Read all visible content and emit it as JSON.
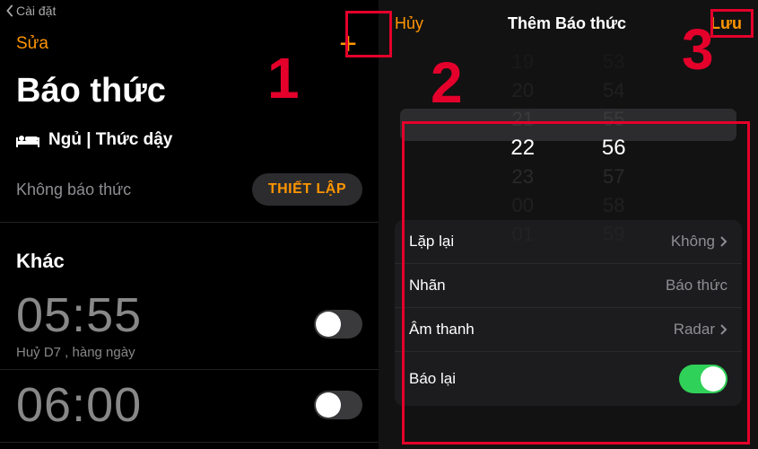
{
  "left": {
    "back": "Cài đặt",
    "edit": "Sửa",
    "title": "Báo thức",
    "sleepWake": "Ngủ | Thức dậy",
    "noAlarm": "Không báo thức",
    "setup": "THIẾT LẬP",
    "other": "Khác",
    "alarms": [
      {
        "time": "05:55",
        "sub": "Huỷ D7 , hàng ngày",
        "on": false
      },
      {
        "time": "06:00",
        "sub": "",
        "on": false
      }
    ]
  },
  "right": {
    "cancel": "Hủy",
    "title": "Thêm Báo thức",
    "save": "Lưu",
    "picker": {
      "hours": [
        "19",
        "20",
        "21",
        "22",
        "23",
        "00",
        "01"
      ],
      "mins": [
        "53",
        "54",
        "55",
        "56",
        "57",
        "58",
        "59"
      ],
      "selectedIndex": 3
    },
    "rows": {
      "repeat": {
        "label": "Lặp lại",
        "value": "Không"
      },
      "label": {
        "label": "Nhãn",
        "value": "Báo thức"
      },
      "sound": {
        "label": "Âm thanh",
        "value": "Radar"
      },
      "snooze": {
        "label": "Báo lại"
      }
    }
  },
  "annotations": {
    "n1": "1",
    "n2": "2",
    "n3": "3"
  }
}
